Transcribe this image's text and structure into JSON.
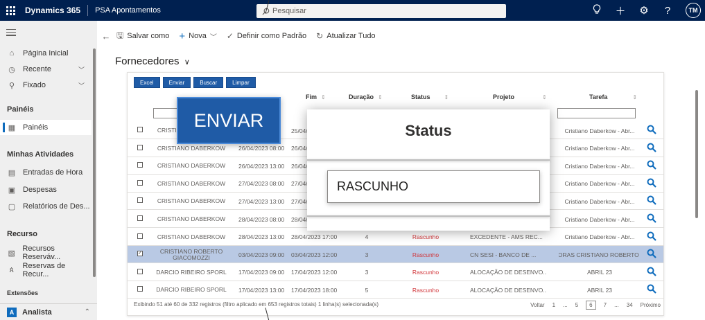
{
  "topbar": {
    "brand": "Dynamics 365",
    "app_name": "PSA Apontamentos",
    "search_placeholder": "Pesquisar",
    "avatar_initials": "TM"
  },
  "sidebar": {
    "items_top": [
      {
        "label": "Página Inicial",
        "icon": "home-icon"
      },
      {
        "label": "Recente",
        "icon": "clock-icon"
      },
      {
        "label": "Fixado",
        "icon": "pin-icon"
      }
    ],
    "section_paineis": "Painéis",
    "paineis_item": "Painéis",
    "section_atividades": "Minhas Atividades",
    "atividades": [
      {
        "label": "Entradas de Hora",
        "icon": "calendar-icon"
      },
      {
        "label": "Despesas",
        "icon": "receipt-icon"
      },
      {
        "label": "Relatórios de Des...",
        "icon": "report-icon"
      }
    ],
    "section_recurso": "Recurso",
    "recurso": [
      {
        "label": "Recursos Reserváv...",
        "icon": "resource-icon"
      },
      {
        "label": "Reservas de Recur...",
        "icon": "people-icon"
      }
    ],
    "section_extensoes": "Extensões",
    "area": {
      "badge": "A",
      "label": "Analista"
    }
  },
  "commandbar": {
    "save_as": "Salvar como",
    "new": "Nova",
    "set_default": "Definir como Padrão",
    "refresh_all": "Atualizar Tudo"
  },
  "view": {
    "title": "Fornecedores"
  },
  "grid": {
    "buttons": [
      "Excel",
      "Enviar",
      "Buscar",
      "Limpar"
    ],
    "headers": {
      "fim": "Fim",
      "duracao": "Duração",
      "status": "Status",
      "projeto": "Projeto",
      "tarefa": "Tarefa"
    },
    "rows": [
      {
        "name": "CRISTIANO DABERKOW",
        "start": "",
        "end": "25/04/",
        "dur": "",
        "status": "",
        "project": "",
        "task": "Cristiano Daberkow - Abr...",
        "checked": false
      },
      {
        "name": "CRISTIANO DABERKOW",
        "start": "26/04/2023 08:00",
        "end": "26/04/",
        "dur": "",
        "status": "",
        "project": "",
        "task": "Cristiano Daberkow - Abr...",
        "checked": false
      },
      {
        "name": "CRISTIANO DABERKOW",
        "start": "26/04/2023 13:00",
        "end": "26/04/",
        "dur": "",
        "status": "",
        "project": "",
        "task": "Cristiano Daberkow - Abr...",
        "checked": false
      },
      {
        "name": "CRISTIANO DABERKOW",
        "start": "27/04/2023 08:00",
        "end": "27/04/",
        "dur": "",
        "status": "",
        "project": "",
        "task": "Cristiano Daberkow - Abr...",
        "checked": false
      },
      {
        "name": "CRISTIANO DABERKOW",
        "start": "27/04/2023 13:00",
        "end": "27/04/",
        "dur": "",
        "status": "",
        "project": "",
        "task": "Cristiano Daberkow - Abr...",
        "checked": false
      },
      {
        "name": "CRISTIANO DABERKOW",
        "start": "28/04/2023 08:00",
        "end": "28/04/",
        "dur": "",
        "status": "",
        "project": "",
        "task": "Cristiano Daberkow - Abr...",
        "checked": false
      },
      {
        "name": "CRISTIANO DABERKOW",
        "start": "28/04/2023 13:00",
        "end": "28/04/2023 17:00",
        "dur": "4",
        "status": "Rascunho",
        "project": "EXCEDENTE - AMS REC...",
        "task": "Cristiano Daberkow - Abr...",
        "checked": false
      },
      {
        "name": "CRISTIANO ROBERTO GIACOMOZZI",
        "start": "03/04/2023 09:00",
        "end": "03/04/2023 12:00",
        "dur": "3",
        "status": "Rascunho",
        "project": "CN SESI - BANCO DE ...",
        "task": "HORAS CRISTIANO ROBERTO ...",
        "checked": true
      },
      {
        "name": "DARCIO RIBEIRO SPORL",
        "start": "17/04/2023 09:00",
        "end": "17/04/2023 12:00",
        "dur": "3",
        "status": "Rascunho",
        "project": "ALOCAÇÃO DE DESENVO...",
        "task": "ABRIL 23",
        "checked": false
      },
      {
        "name": "DARCIO RIBEIRO SPORL",
        "start": "17/04/2023 13:00",
        "end": "17/04/2023 18:00",
        "dur": "5",
        "status": "Rascunho",
        "project": "ALOCAÇÃO DE DESENVO...",
        "task": "ABRIL 23",
        "checked": false
      }
    ],
    "footer_info": "Exibindo 51 até 60 de 332 registros (filtro aplicado em 653 registros totais)   1 linha(s) selecionada(s)",
    "pager": [
      "Voltar",
      "1",
      "...",
      "5",
      "6",
      "7",
      "...",
      "34",
      "Próximo"
    ],
    "pager_current": "6"
  },
  "callouts": {
    "enviar": "ENVIAR",
    "status_title": "Status",
    "status_value": "RASCUNHO"
  },
  "colors": {
    "topbar": "#002050",
    "button_blue": "#1f5ba6",
    "selected_row": "#b9c9e4",
    "status_red": "#d13438"
  }
}
